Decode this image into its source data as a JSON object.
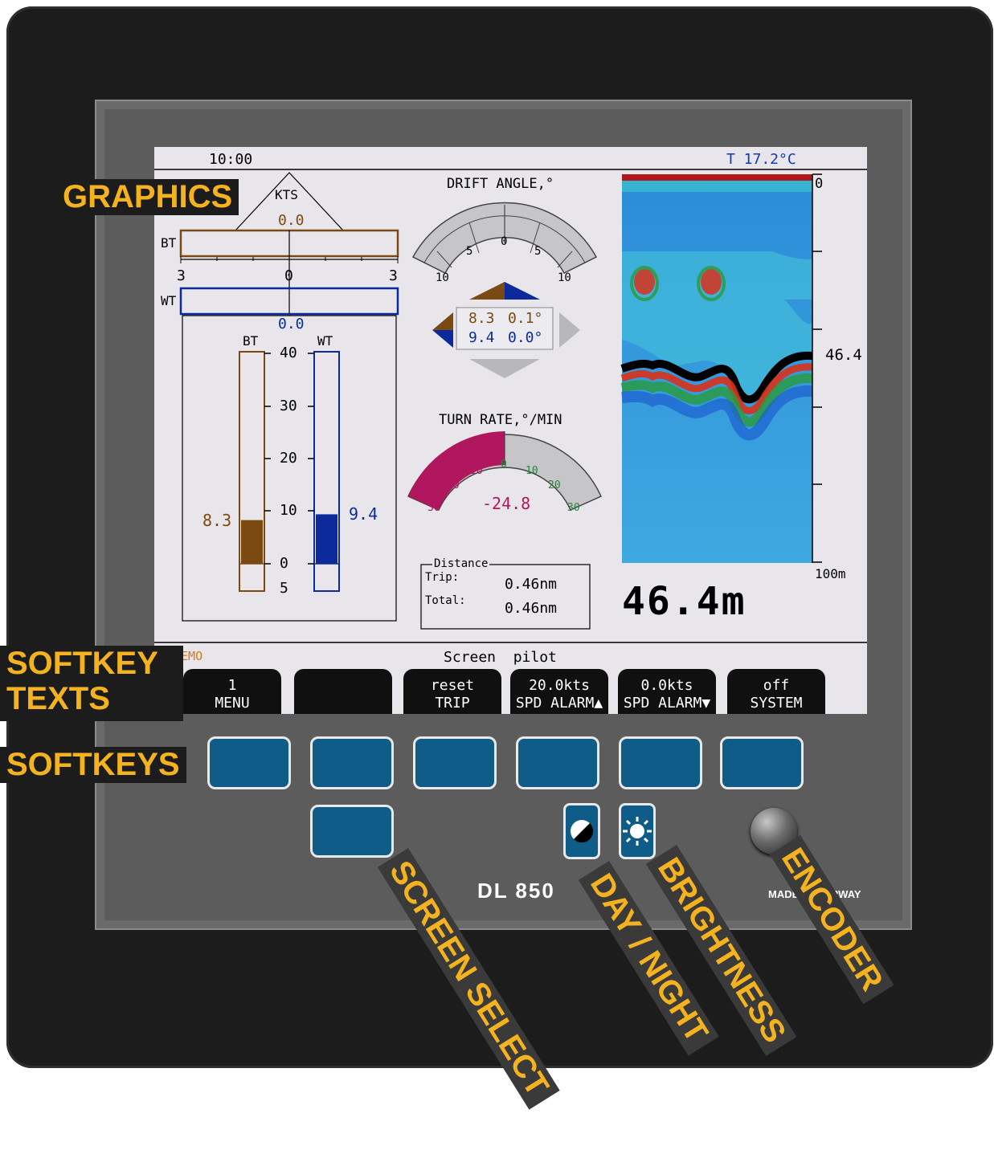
{
  "device": {
    "model": "DL 850",
    "made_in": "MADE IN NORWAY"
  },
  "callouts": {
    "graphics": "GRAPHICS",
    "softkey_texts_line1": "SOFTKEY",
    "softkey_texts_line2": "TEXTS",
    "softkeys": "SOFTKEYS",
    "screen_select": "SCREEN SELECT",
    "day_night": "DAY / NIGHT",
    "brightness": "BRIGHTNESS",
    "encoder": "ENCODER"
  },
  "screen": {
    "time": "10:00",
    "temperature": "T 17.2°C",
    "kts_label": "KTS",
    "bt_value": "0.0",
    "wt_value": "0.0",
    "bt_tag": "BT",
    "wt_tag": "WT",
    "scale_left": "3",
    "scale_mid": "0",
    "scale_right": "3",
    "bars": {
      "bt_label": "BT",
      "wt_label": "WT",
      "bt_value": "8.3",
      "wt_value": "9.4",
      "ticks": [
        "40",
        "30",
        "20",
        "10",
        "0",
        "5"
      ],
      "bt_level": 8.3,
      "wt_level": 9.4,
      "max": 40
    },
    "drift": {
      "title": "DRIFT ANGLE,°",
      "ticks": [
        "10",
        "5",
        "0",
        "5",
        "10"
      ],
      "row1_speed": "8.3",
      "row1_angle": "0.1°",
      "row2_speed": "9.4",
      "row2_angle": "0.0°"
    },
    "turn": {
      "title": "TURN RATE,°/MIN",
      "value": "-24.8",
      "ticks_left": [
        "30",
        "20",
        "10"
      ],
      "tick_zero": "0",
      "ticks_right": [
        "10",
        "20",
        "30"
      ]
    },
    "distance": {
      "legend": "Distance",
      "trip_label": "Trip:",
      "trip_value": "0.46nm",
      "total_label": "Total:",
      "total_value": "0.46nm"
    },
    "echo": {
      "top_depth": "0",
      "mid_depth": "46.4",
      "bottom_depth": "100m",
      "depth_readout": "46.4m"
    },
    "demo": "DEMO",
    "screen_name": "Screen  pilot",
    "softkeys": [
      {
        "line1": "1",
        "line2": "MENU"
      },
      {
        "line1": "",
        "line2": ""
      },
      {
        "line1": "reset",
        "line2": "TRIP"
      },
      {
        "line1": "20.0kts",
        "line2": "SPD ALARM▲"
      },
      {
        "line1": "0.0kts",
        "line2": "SPD ALARM▼"
      },
      {
        "line1": "off",
        "line2": "SYSTEM"
      }
    ]
  },
  "colors": {
    "callout": "#f4b31e",
    "softkey": "#0e5c87",
    "bt": "#7a4a12",
    "wt": "#0c2a9c",
    "turn_fill": "#b0175e"
  },
  "icons": [
    "day-night-icon",
    "brightness-icon",
    "encoder-knob-icon"
  ]
}
